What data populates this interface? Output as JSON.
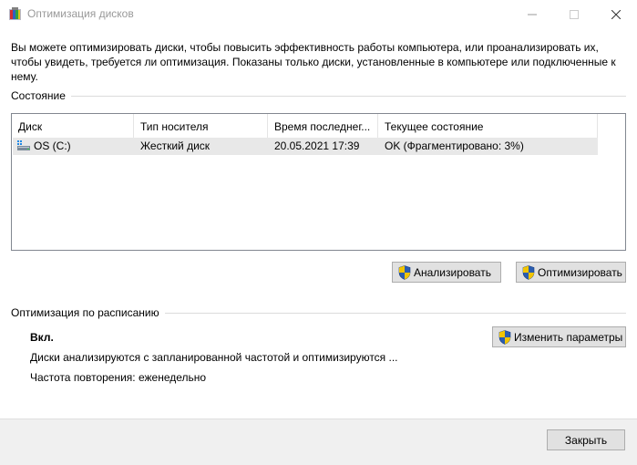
{
  "window": {
    "title": "Оптимизация дисков"
  },
  "description": "Вы можете оптимизировать диски, чтобы повысить эффективность работы  компьютера, или проанализировать их, чтобы увидеть, требуется ли оптимизация. Показаны только диски, установленные в компьютере или подключенные к нему.",
  "status_group": {
    "label": "Состояние",
    "columns": [
      "Диск",
      "Тип носителя",
      "Время последнег...",
      "Текущее состояние"
    ],
    "rows": [
      {
        "disk": "OS (C:)",
        "media_type": "Жесткий диск",
        "last_run": "20.05.2021 17:39",
        "current_state": "OK (Фрагментировано: 3%)",
        "icon": "drive-icon"
      }
    ]
  },
  "actions": {
    "analyze_label": "Анализировать",
    "optimize_label": "Оптимизировать"
  },
  "schedule": {
    "label": "Оптимизация по расписанию",
    "state": "Вкл.",
    "description": "Диски анализируются с запланированной частотой и оптимизируются ...",
    "frequency": "Частота повторения: еженедельно",
    "change_label": "Изменить параметры"
  },
  "footer": {
    "close_label": "Закрыть"
  },
  "colors": {
    "selected_row": "#e8e8e8",
    "button_face": "#e1e1e1",
    "footer_bg": "#f0f0f0"
  }
}
